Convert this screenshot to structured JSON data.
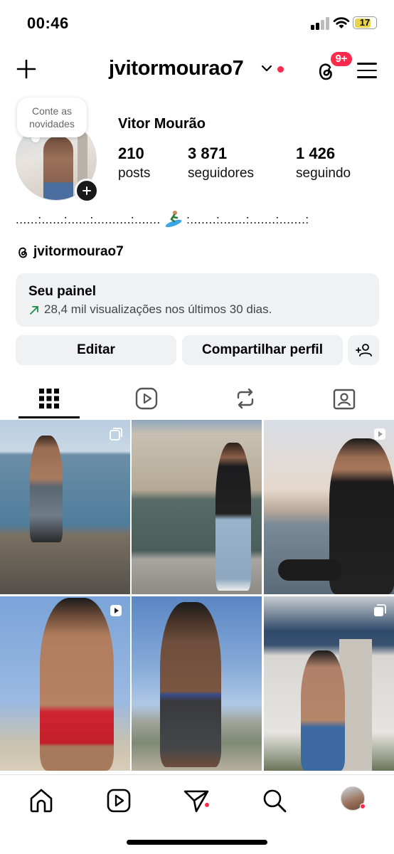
{
  "status_bar": {
    "time": "00:46",
    "battery": "17"
  },
  "header": {
    "username": "jvitormourao7",
    "threads_badge": "9+"
  },
  "profile": {
    "note": "Conte as novidades",
    "display_name": "Vitor Mourão",
    "stats": [
      {
        "value": "210",
        "label": "posts"
      },
      {
        "value": "3 871",
        "label": "seguidores"
      },
      {
        "value": "1 426",
        "label": "seguindo"
      }
    ],
    "bio_left": "......:......:......:..........:.......",
    "bio_right": ":.......:.......:.......:.......:",
    "threads_handle": "jvitormourao7"
  },
  "dashboard": {
    "title": "Seu painel",
    "subtitle": "28,4 mil visualizações nos últimos 30 dias."
  },
  "buttons": {
    "edit": "Editar",
    "share": "Compartilhar perfil"
  },
  "tabs": [
    "grid-icon",
    "reels-icon",
    "reposts-icon",
    "tagged-icon"
  ],
  "colors": {
    "accent_red": "#ff2a4b",
    "button_bg": "#eff1f3"
  }
}
